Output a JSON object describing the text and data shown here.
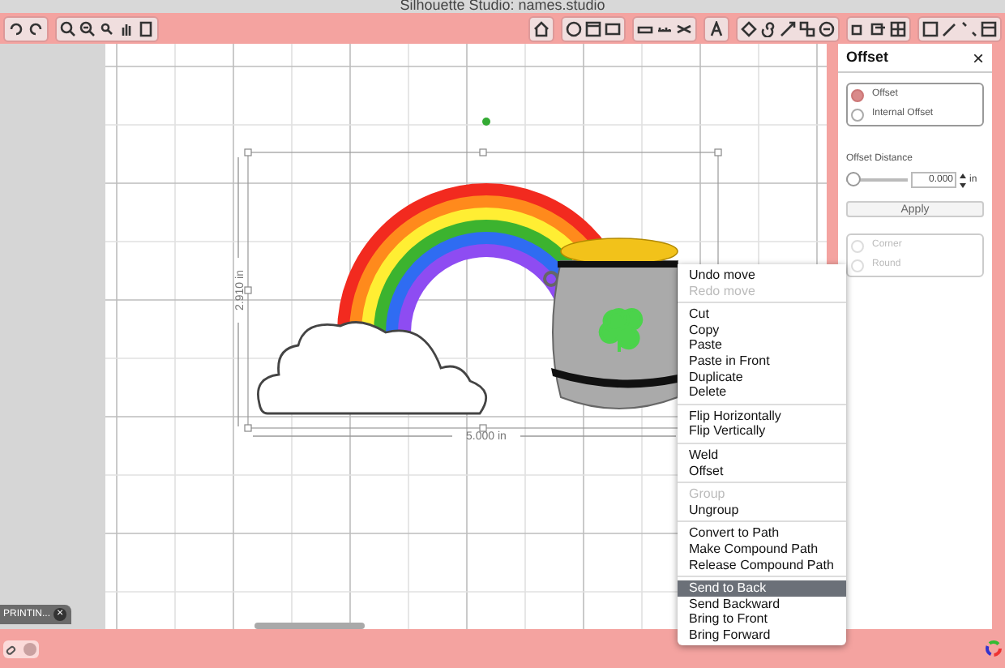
{
  "window": {
    "title": "Silhouette Studio: names.studio"
  },
  "canvas": {
    "height_label": "2.910 in",
    "width_label": "5.000 in"
  },
  "document_tab": {
    "label": "PRINTIN...",
    "close": "×"
  },
  "context_menu": {
    "groups": [
      [
        {
          "label": "Undo move",
          "disabled": false,
          "selected": false
        },
        {
          "label": "Redo move",
          "disabled": true,
          "selected": false
        }
      ],
      [
        {
          "label": "Cut",
          "disabled": false,
          "selected": false
        },
        {
          "label": "Copy",
          "disabled": false,
          "selected": false
        },
        {
          "label": "Paste",
          "disabled": false,
          "selected": false
        },
        {
          "label": "Paste in Front",
          "disabled": false,
          "selected": false
        },
        {
          "label": "Duplicate",
          "disabled": false,
          "selected": false
        },
        {
          "label": "Delete",
          "disabled": false,
          "selected": false
        }
      ],
      [
        {
          "label": "Flip Horizontally",
          "disabled": false,
          "selected": false
        },
        {
          "label": "Flip Vertically",
          "disabled": false,
          "selected": false
        }
      ],
      [
        {
          "label": "Weld",
          "disabled": false,
          "selected": false
        },
        {
          "label": "Offset",
          "disabled": false,
          "selected": false
        }
      ],
      [
        {
          "label": "Group",
          "disabled": true,
          "selected": false
        },
        {
          "label": "Ungroup",
          "disabled": false,
          "selected": false
        }
      ],
      [
        {
          "label": "Convert to Path",
          "disabled": false,
          "selected": false
        },
        {
          "label": "Make Compound Path",
          "disabled": false,
          "selected": false
        },
        {
          "label": "Release Compound Path",
          "disabled": false,
          "selected": false
        }
      ],
      [
        {
          "label": "Send to Back",
          "disabled": false,
          "selected": true
        },
        {
          "label": "Send Backward",
          "disabled": false,
          "selected": false
        },
        {
          "label": "Bring to Front",
          "disabled": false,
          "selected": false
        },
        {
          "label": "Bring Forward",
          "disabled": false,
          "selected": false
        }
      ]
    ]
  },
  "offset_panel": {
    "title": "Offset",
    "close": "×",
    "mode_options": [
      {
        "label": "Offset",
        "selected": true
      },
      {
        "label": "Internal Offset",
        "selected": false
      }
    ],
    "distance_label": "Offset Distance",
    "distance": {
      "level": 0,
      "value": "0.000",
      "unit": "in"
    },
    "apply": "Apply",
    "corner_options": [
      {
        "label": "Corner",
        "selected": false,
        "disabled": true
      },
      {
        "label": "Round",
        "selected": false,
        "disabled": true
      }
    ]
  }
}
